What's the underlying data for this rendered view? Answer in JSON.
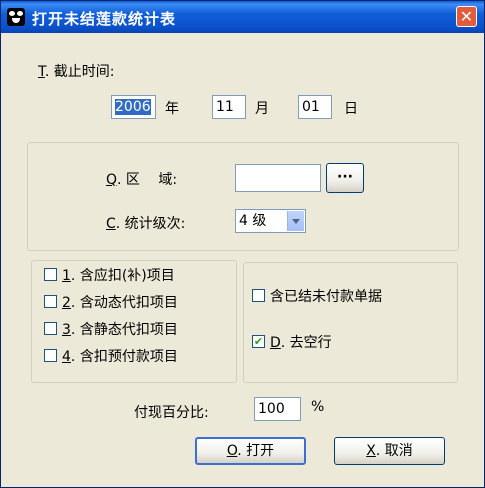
{
  "window": {
    "title": "打开未结莲款统计表",
    "close_glyph": "✕"
  },
  "cutoff": {
    "label_key": "T",
    "label_rest": ". 截止时间:",
    "year": "2006",
    "year_unit": "年",
    "month": "11",
    "month_unit": "月",
    "day": "01",
    "day_unit": "日"
  },
  "region": {
    "label_key": "Q",
    "label_rest": ". 区　  域:",
    "value": "",
    "browse_label": "···"
  },
  "level": {
    "label_key": "C",
    "label_rest": ". 统计级次:",
    "value": "4 级"
  },
  "left_options": [
    {
      "key": "1",
      "text": ". 含应扣(补)项目",
      "checked": false
    },
    {
      "key": "2",
      "text": ". 含动态代扣项目",
      "checked": false
    },
    {
      "key": "3",
      "text": ". 含静态代扣项目",
      "checked": false
    },
    {
      "key": "4",
      "text": ". 含扣预付款项目",
      "checked": false
    }
  ],
  "right_options": [
    {
      "key": "",
      "text": "含已结未付款单据",
      "checked": false
    },
    {
      "key": "D",
      "text": ". 去空行",
      "checked": true
    }
  ],
  "percent": {
    "label": "付现百分比:",
    "value": "100",
    "unit": "%"
  },
  "buttons": {
    "open": {
      "key": "O",
      "rest": ". 打开"
    },
    "cancel": {
      "key": "X",
      "rest": ". 取消"
    }
  },
  "checkmark": "✔"
}
